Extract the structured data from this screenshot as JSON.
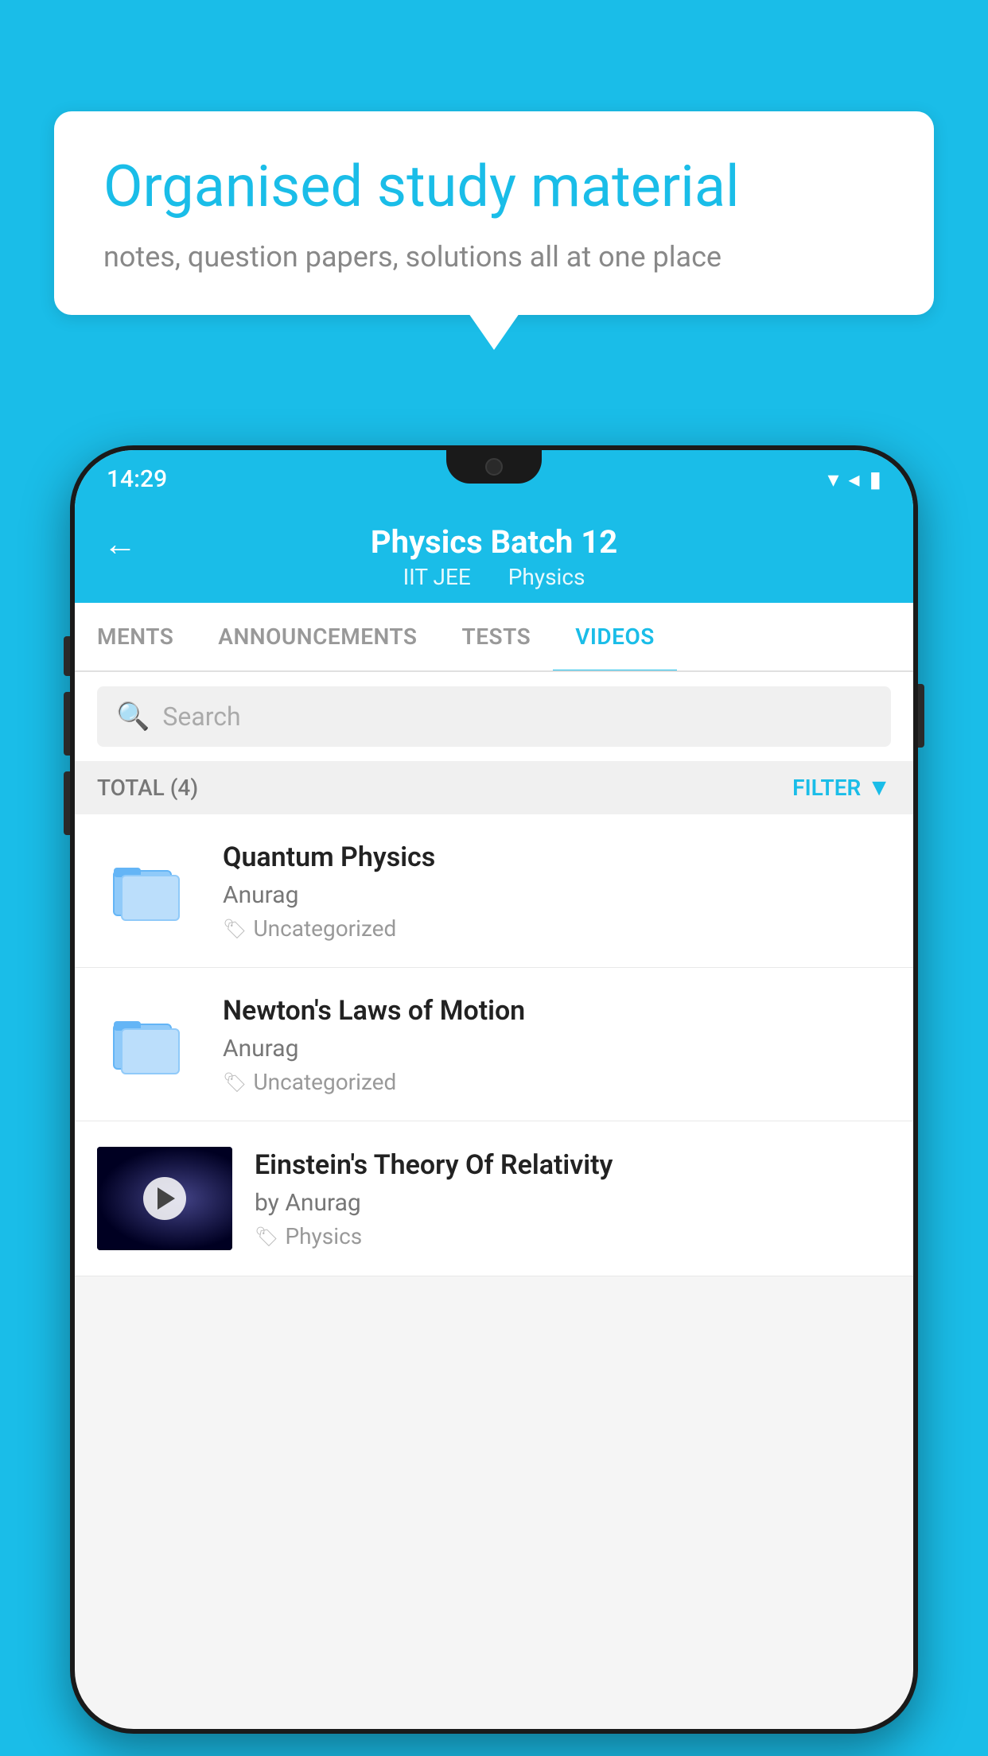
{
  "background_color": "#1abde8",
  "speech_bubble": {
    "title": "Organised study material",
    "subtitle": "notes, question papers, solutions all at one place"
  },
  "status_bar": {
    "time": "14:29",
    "icons": [
      "wifi",
      "signal",
      "battery"
    ]
  },
  "app_header": {
    "title": "Physics Batch 12",
    "subtitle_part1": "IIT JEE",
    "subtitle_part2": "Physics",
    "back_arrow": "←"
  },
  "tabs": [
    {
      "label": "MENTS",
      "active": false
    },
    {
      "label": "ANNOUNCEMENTS",
      "active": false
    },
    {
      "label": "TESTS",
      "active": false
    },
    {
      "label": "VIDEOS",
      "active": true
    }
  ],
  "search": {
    "placeholder": "Search"
  },
  "filter_bar": {
    "total_label": "TOTAL (4)",
    "filter_label": "FILTER"
  },
  "videos": [
    {
      "title": "Quantum Physics",
      "author": "Anurag",
      "tag": "Uncategorized",
      "has_thumbnail": false
    },
    {
      "title": "Newton's Laws of Motion",
      "author": "Anurag",
      "tag": "Uncategorized",
      "has_thumbnail": false
    },
    {
      "title": "Einstein's Theory Of Relativity",
      "author": "by Anurag",
      "tag": "Physics",
      "has_thumbnail": true
    }
  ]
}
